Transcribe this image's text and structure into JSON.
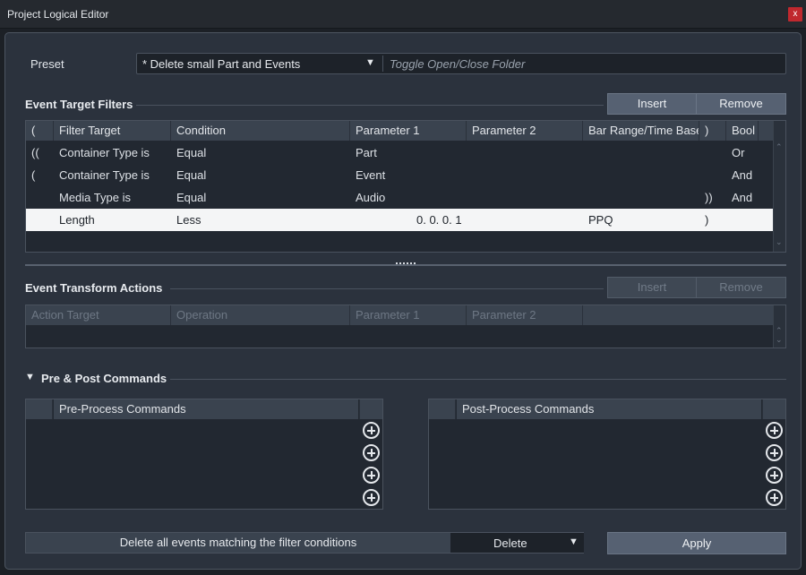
{
  "window": {
    "title": "Project Logical Editor",
    "close_label": "x"
  },
  "preset": {
    "label": "Preset",
    "value": "* Delete small Part and Events",
    "arrow": "▼",
    "comment": "Toggle Open/Close Folder"
  },
  "filters": {
    "title": "Event Target Filters",
    "insert_label": "Insert",
    "remove_label": "Remove",
    "columns": [
      "(",
      "Filter Target",
      "Condition",
      "Parameter 1",
      "Parameter 2",
      "Bar Range/Time Base",
      ")",
      "Bool"
    ],
    "rows": [
      {
        "open": "((",
        "target": "Container Type is",
        "condition": "Equal",
        "param1": "Part",
        "param2": "",
        "range": "",
        "close": "",
        "bool": "Or"
      },
      {
        "open": "(",
        "target": "Container Type is",
        "condition": "Equal",
        "param1": "Event",
        "param2": "",
        "range": "",
        "close": "",
        "bool": "And"
      },
      {
        "open": "",
        "target": "Media Type is",
        "condition": "Equal",
        "param1": "Audio",
        "param2": "",
        "range": "",
        "close": "))",
        "bool": "And"
      },
      {
        "open": "",
        "target": "Length",
        "condition": "Less",
        "param1": "0. 0. 0.  1",
        "param2": "",
        "range": "PPQ",
        "close": ")",
        "bool": ""
      }
    ],
    "selected_row": 3
  },
  "actions": {
    "title": "Event Transform Actions",
    "insert_label": "Insert",
    "remove_label": "Remove",
    "columns": [
      "Action Target",
      "Operation",
      "Parameter 1",
      "Parameter 2"
    ]
  },
  "commands": {
    "title": "Pre & Post Commands",
    "expand_arrow": "▼",
    "pre_title": "Pre-Process Commands",
    "post_title": "Post-Process Commands"
  },
  "footer": {
    "function_text": "Delete all events matching the filter conditions",
    "function_value": "Delete",
    "function_arrow": "▼",
    "apply_label": "Apply"
  },
  "colors": {
    "background": "#2b323d",
    "header": "#3a434f",
    "selected_row": "#f4f5f6",
    "close_button": "#c0282e"
  }
}
